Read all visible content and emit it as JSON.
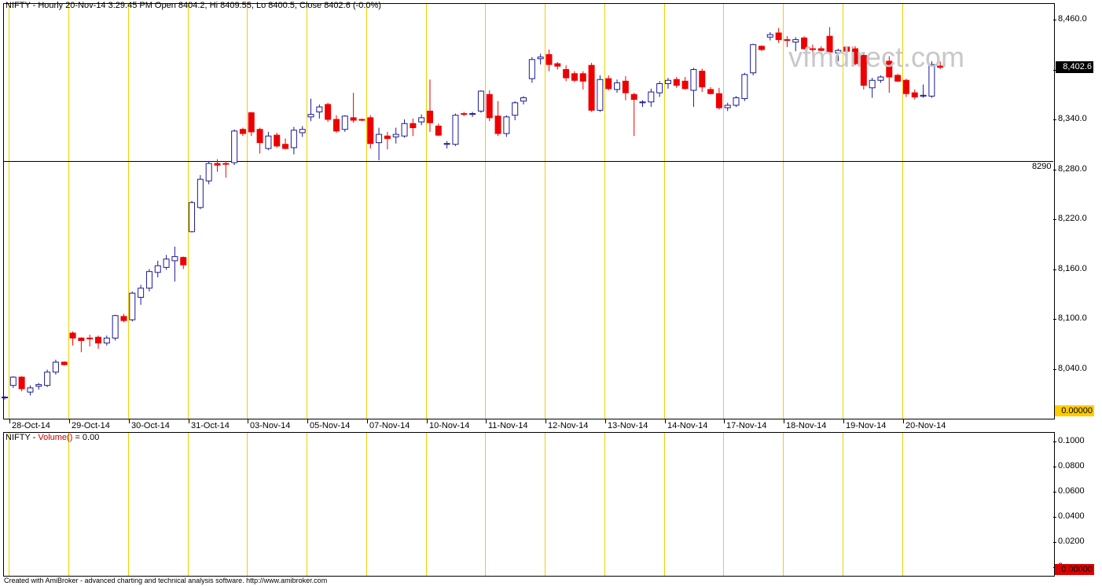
{
  "chart": {
    "title": "NIFTY - Hourly 20-Nov-14 3:29:45 PM Open 8404.2, Hi 8409.55, Lo 8400.5, Close 8402.6 (-0.0%)",
    "watermark": "vfmdirect.com",
    "last_price_label": "8,402.6",
    "horizontal_line_label": "8290",
    "volume_zero_label_price": "0.00000",
    "volume_zero_label_vol": "0.00000",
    "footer": "Created with AmiBroker - advanced charting and technical analysis software. http://www.amibroker.com",
    "colors": {
      "up": "#1a1a99",
      "down": "#ee0000",
      "separator": "#f0d000"
    }
  },
  "volume_panel": {
    "title_prefix": "NIFTY - ",
    "title_indicator": "Volume()",
    "title_value": " = 0.00",
    "y_ticks": [
      "0.1000",
      "0.0800",
      "0.0600",
      "0.0400",
      "0.0200",
      "0"
    ]
  },
  "chart_data": {
    "type": "candlestick",
    "title": "NIFTY - Hourly 20-Nov-14 3:29:45 PM Open 8404.2, Hi 8409.55, Lo 8400.5, Close 8402.6 (-0.0%)",
    "y_ticks": [
      "8,460.0",
      "8,400.0",
      "8,340.0",
      "8,280.0",
      "8,220.0",
      "8,160.0",
      "8,100.0",
      "8,040.0"
    ],
    "ylim": [
      7980,
      8485
    ],
    "x_ticks": [
      "28-Oct-14",
      "29-Oct-14",
      "30-Oct-14",
      "31-Oct-14",
      "03-Nov-14",
      "05-Nov-14",
      "07-Nov-14",
      "10-Nov-14",
      "11-Nov-14",
      "12-Nov-14",
      "13-Nov-14",
      "14-Nov-14",
      "17-Nov-14",
      "18-Nov-14",
      "19-Nov-14",
      "20-Nov-14"
    ],
    "horizontal_line": 8290,
    "last_close": 8402.6,
    "candles": [
      [
        8005,
        8007,
        8003,
        8006
      ],
      [
        8020,
        8031,
        8017,
        8030
      ],
      [
        8030,
        8031,
        8013,
        8016
      ],
      [
        8012,
        8020,
        8008,
        8017
      ],
      [
        8019,
        8023,
        8015,
        8021
      ],
      [
        8020,
        8039,
        8018,
        8036
      ],
      [
        8036,
        8051,
        8033,
        8048
      ],
      [
        8048,
        8049,
        8044,
        8045
      ],
      [
        8083,
        8085,
        8068,
        8077
      ],
      [
        8077,
        8078,
        8060,
        8074
      ],
      [
        8077,
        8081,
        8067,
        8076
      ],
      [
        8078,
        8080,
        8064,
        8071
      ],
      [
        8071,
        8080,
        8068,
        8077
      ],
      [
        8077,
        8105,
        8074,
        8104
      ],
      [
        8103,
        8106,
        8096,
        8098
      ],
      [
        8099,
        8133,
        8097,
        8131
      ],
      [
        8126,
        8141,
        8117,
        8137
      ],
      [
        8137,
        8160,
        8133,
        8157
      ],
      [
        8156,
        8170,
        8150,
        8164
      ],
      [
        8162,
        8177,
        8159,
        8172
      ],
      [
        8170,
        8187,
        8145,
        8175
      ],
      [
        8174,
        8175,
        8160,
        8165
      ],
      [
        8205,
        8242,
        8204,
        8240
      ],
      [
        8234,
        8273,
        8232,
        8268
      ],
      [
        8266,
        8290,
        8262,
        8287
      ],
      [
        8287,
        8292,
        8277,
        8285
      ],
      [
        8287,
        8290,
        8270,
        8286
      ],
      [
        8288,
        8328,
        8285,
        8326
      ],
      [
        8328,
        8330,
        8320,
        8323
      ],
      [
        8348,
        8349,
        8320,
        8325
      ],
      [
        8328,
        8330,
        8299,
        8312
      ],
      [
        8305,
        8325,
        8303,
        8320
      ],
      [
        8321,
        8324,
        8306,
        8308
      ],
      [
        8310,
        8317,
        8304,
        8305
      ],
      [
        8306,
        8331,
        8298,
        8327
      ],
      [
        8324,
        8332,
        8319,
        8328
      ],
      [
        8343,
        8365,
        8338,
        8346
      ],
      [
        8349,
        8358,
        8341,
        8355
      ],
      [
        8358,
        8360,
        8337,
        8340
      ],
      [
        8340,
        8345,
        8324,
        8326
      ],
      [
        8328,
        8345,
        8325,
        8344
      ],
      [
        8342,
        8372,
        8336,
        8339
      ],
      [
        8340,
        8341,
        8338,
        8339
      ],
      [
        8342,
        8345,
        8305,
        8311
      ],
      [
        8312,
        8330,
        8291,
        8322
      ],
      [
        8320,
        8325,
        8304,
        8317
      ],
      [
        8319,
        8330,
        8311,
        8322
      ],
      [
        8320,
        8340,
        8318,
        8335
      ],
      [
        8335,
        8341,
        8320,
        8330
      ],
      [
        8337,
        8346,
        8333,
        8342
      ],
      [
        8350,
        8388,
        8325,
        8336
      ],
      [
        8332,
        8335,
        8320,
        8321
      ],
      [
        8310,
        8314,
        8305,
        8311
      ],
      [
        8310,
        8347,
        8308,
        8345
      ],
      [
        8347,
        8349,
        8344,
        8346
      ],
      [
        8346,
        8349,
        8343,
        8347
      ],
      [
        8350,
        8375,
        8348,
        8374
      ],
      [
        8370,
        8375,
        8338,
        8342
      ],
      [
        8344,
        8362,
        8320,
        8323
      ],
      [
        8323,
        8345,
        8319,
        8343
      ],
      [
        8345,
        8362,
        8339,
        8360
      ],
      [
        8362,
        8368,
        8358,
        8366
      ],
      [
        8389,
        8415,
        8384,
        8412
      ],
      [
        8413,
        8419,
        8406,
        8415
      ],
      [
        8418,
        8424,
        8398,
        8406
      ],
      [
        8407,
        8409,
        8400,
        8404
      ],
      [
        8400,
        8405,
        8386,
        8390
      ],
      [
        8395,
        8398,
        8385,
        8387
      ],
      [
        8395,
        8398,
        8376,
        8386
      ],
      [
        8405,
        8408,
        8349,
        8351
      ],
      [
        8351,
        8393,
        8349,
        8388
      ],
      [
        8389,
        8393,
        8375,
        8377
      ],
      [
        8376,
        8388,
        8372,
        8384
      ],
      [
        8386,
        8392,
        8363,
        8372
      ],
      [
        8370,
        8372,
        8320,
        8364
      ],
      [
        8360,
        8363,
        8355,
        8361
      ],
      [
        8361,
        8377,
        8355,
        8373
      ],
      [
        8372,
        8386,
        8367,
        8383
      ],
      [
        8383,
        8390,
        8377,
        8387
      ],
      [
        8388,
        8391,
        8378,
        8381
      ],
      [
        8386,
        8391,
        8376,
        8377
      ],
      [
        8375,
        8402,
        8355,
        8400
      ],
      [
        8398,
        8401,
        8373,
        8379
      ],
      [
        8376,
        8379,
        8370,
        8371
      ],
      [
        8371,
        8378,
        8352,
        8354
      ],
      [
        8354,
        8360,
        8350,
        8357
      ],
      [
        8357,
        8368,
        8355,
        8366
      ],
      [
        8365,
        8396,
        8362,
        8394
      ],
      [
        8396,
        8431,
        8393,
        8430
      ],
      [
        8428,
        8429,
        8422,
        8424
      ],
      [
        8439,
        8445,
        8435,
        8442
      ],
      [
        8444,
        8450,
        8432,
        8436
      ],
      [
        8436,
        8440,
        8427,
        8435
      ],
      [
        8433,
        8439,
        8422,
        8436
      ],
      [
        8438,
        8440,
        8424,
        8425
      ],
      [
        8425,
        8430,
        8415,
        8424
      ],
      [
        8425,
        8428,
        8422,
        8423
      ],
      [
        8440,
        8451,
        8420,
        8421
      ],
      [
        8420,
        8425,
        8410,
        8423
      ],
      [
        8427,
        8428,
        8419,
        8422
      ],
      [
        8425,
        8428,
        8405,
        8407
      ],
      [
        8417,
        8419,
        8376,
        8381
      ],
      [
        8378,
        8390,
        8366,
        8387
      ],
      [
        8387,
        8393,
        8384,
        8391
      ],
      [
        8410,
        8416,
        8372,
        8391
      ],
      [
        8393,
        8395,
        8385,
        8386
      ],
      [
        8387,
        8389,
        8367,
        8371
      ],
      [
        8372,
        8376,
        8364,
        8367
      ],
      [
        8368,
        8382,
        8366,
        8369
      ],
      [
        8368,
        8410,
        8366,
        8406
      ],
      [
        8404.2,
        8409.55,
        8400.5,
        8402.6
      ]
    ],
    "day_starts": [
      1,
      8,
      15,
      22,
      29,
      36,
      43,
      50,
      57,
      64,
      71,
      78,
      85,
      92,
      99,
      106
    ]
  }
}
